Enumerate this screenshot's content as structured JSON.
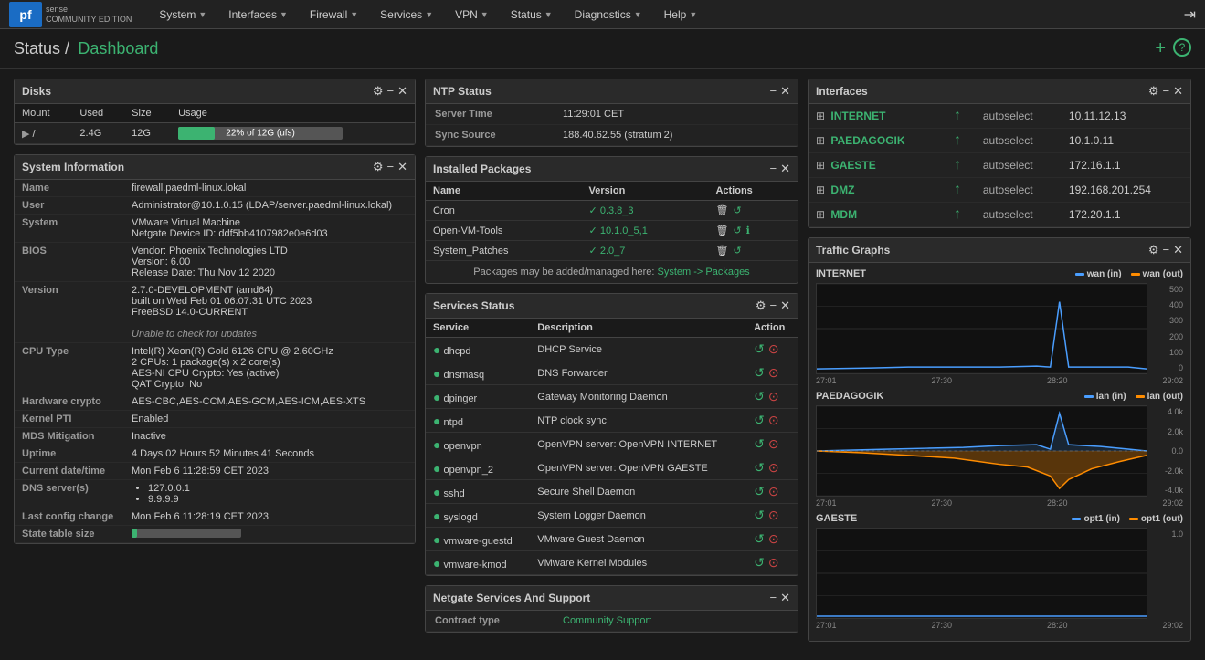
{
  "navbar": {
    "brand": "pf",
    "brand_sub": "COMMUNITY EDITION",
    "items": [
      {
        "label": "System",
        "id": "system"
      },
      {
        "label": "Interfaces",
        "id": "interfaces"
      },
      {
        "label": "Firewall",
        "id": "firewall"
      },
      {
        "label": "Services",
        "id": "services"
      },
      {
        "label": "VPN",
        "id": "vpn"
      },
      {
        "label": "Status",
        "id": "status"
      },
      {
        "label": "Diagnostics",
        "id": "diagnostics"
      },
      {
        "label": "Help",
        "id": "help"
      }
    ]
  },
  "breadcrumb": {
    "prefix": "Status /",
    "current": "Dashboard"
  },
  "disks": {
    "title": "Disks",
    "headers": [
      "Mount",
      "Used",
      "Size",
      "Usage"
    ],
    "rows": [
      {
        "mount": "/",
        "used": "2.4G",
        "size": "12G",
        "usage_pct": 22,
        "usage_label": "22% of 12G (ufs)"
      }
    ]
  },
  "sysinfo": {
    "title": "System Information",
    "rows": [
      {
        "label": "Name",
        "value": "firewall.paedml-linux.lokal"
      },
      {
        "label": "User",
        "value": "Administrator@10.1.0.15 (LDAP/server.paedml-linux.lokal)"
      },
      {
        "label": "System",
        "value": "VMware Virtual Machine\nNetgate Device ID: ddf5bb4107982e0e6d03"
      },
      {
        "label": "BIOS",
        "value": "Vendor: Phoenix Technologies LTD\nVersion: 6.00\nRelease Date: Thu Nov 12 2020"
      },
      {
        "label": "Version",
        "value": "2.7.0-DEVELOPMENT (amd64)\nbuilt on Wed Feb 01 06:07:31 UTC 2023\nFreeBSD 14.0-CURRENT\n\nUnable to check for updates"
      },
      {
        "label": "CPU Type",
        "value": "Intel(R) Xeon(R) Gold 6126 CPU @ 2.60GHz\n2 CPUs: 1 package(s) x 2 core(s)\nAES-NI CPU Crypto: Yes (active)\nQAT Crypto: No"
      },
      {
        "label": "Hardware crypto",
        "value": "AES-CBC,AES-CCM,AES-GCM,AES-ICM,AES-XTS"
      },
      {
        "label": "Kernel PTI",
        "value": "Enabled"
      },
      {
        "label": "MDS Mitigation",
        "value": "Inactive"
      },
      {
        "label": "Uptime",
        "value": "4 Days 02 Hours 52 Minutes 41 Seconds"
      },
      {
        "label": "Current date/time",
        "value": "Mon Feb 6 11:28:59 CET 2023"
      },
      {
        "label": "DNS server(s)",
        "value": "127.0.0.1\n9.9.9.9"
      },
      {
        "label": "Last config change",
        "value": "Mon Feb 6 11:28:19 CET 2023"
      },
      {
        "label": "State table size",
        "value": ""
      }
    ]
  },
  "ntp": {
    "title": "NTP Status",
    "rows": [
      {
        "label": "Server Time",
        "value": "11:29:01 CET"
      },
      {
        "label": "Sync Source",
        "value": "188.40.62.55 (stratum 2)"
      }
    ]
  },
  "packages": {
    "title": "Installed Packages",
    "headers": [
      "Name",
      "Version",
      "Actions"
    ],
    "rows": [
      {
        "name": "Cron",
        "version": "0.3.8_3"
      },
      {
        "name": "Open-VM-Tools",
        "version": "10.1.0_5,1"
      },
      {
        "name": "System_Patches",
        "version": "2.0_7"
      }
    ],
    "note": "Packages may be added/managed here: System -> Packages"
  },
  "services": {
    "title": "Services Status",
    "headers": [
      "Service",
      "Description",
      "Action"
    ],
    "rows": [
      {
        "name": "dhcpd",
        "desc": "DHCP Service"
      },
      {
        "name": "dnsmasq",
        "desc": "DNS Forwarder"
      },
      {
        "name": "dpinger",
        "desc": "Gateway Monitoring Daemon"
      },
      {
        "name": "ntpd",
        "desc": "NTP clock sync"
      },
      {
        "name": "openvpn",
        "desc": "OpenVPN server: OpenVPN INTERNET"
      },
      {
        "name": "openvpn_2",
        "desc": "OpenVPN server: OpenVPN GAESTE"
      },
      {
        "name": "sshd",
        "desc": "Secure Shell Daemon"
      },
      {
        "name": "syslogd",
        "desc": "System Logger Daemon"
      },
      {
        "name": "vmware-guestd",
        "desc": "VMware Guest Daemon"
      },
      {
        "name": "vmware-kmod",
        "desc": "VMware Kernel Modules"
      }
    ]
  },
  "netgate": {
    "title": "Netgate Services And Support",
    "rows": [
      {
        "label": "Contract type",
        "value": "Community Support"
      }
    ]
  },
  "interfaces": {
    "title": "Interfaces",
    "rows": [
      {
        "name": "INTERNET",
        "type": "autoselect",
        "ip": "10.11.12.13"
      },
      {
        "name": "PAEDAGOGIK",
        "type": "autoselect",
        "ip": "10.1.0.11"
      },
      {
        "name": "GAESTE",
        "type": "autoselect",
        "ip": "172.16.1.1"
      },
      {
        "name": "DMZ",
        "type": "autoselect",
        "ip": "192.168.201.254"
      },
      {
        "name": "MDM",
        "type": "autoselect",
        "ip": "172.20.1.1"
      }
    ]
  },
  "traffic_graphs": {
    "title": "Traffic Graphs",
    "graphs": [
      {
        "id": "internet",
        "title": "INTERNET",
        "legend_in": "wan (in)",
        "legend_out": "wan (out)",
        "color_in": "#1e90ff",
        "color_out": "#ff8c00",
        "y_labels": [
          "500",
          "400",
          "300",
          "200",
          "100",
          "0"
        ],
        "time_labels": [
          "27:01",
          "27:30",
          "28:20",
          "29:02"
        ]
      },
      {
        "id": "paedagogik",
        "title": "PAEDAGOGIK",
        "legend_in": "lan (in)",
        "legend_out": "lan (out)",
        "color_in": "#1e90ff",
        "color_out": "#ff8c00",
        "y_labels": [
          "4.0k",
          "2.0k",
          "0.0",
          "-2.0k",
          "-4.0k"
        ],
        "time_labels": [
          "27:01",
          "27:30",
          "28:20",
          "29:02"
        ]
      },
      {
        "id": "gaeste",
        "title": "GAESTE",
        "legend_in": "opt1 (in)",
        "legend_out": "opt1 (out)",
        "color_in": "#1e90ff",
        "color_out": "#ff8c00",
        "y_labels": [
          "1.0",
          "",
          "",
          "",
          ""
        ],
        "time_labels": [
          "27:01",
          "27:30",
          "28:20",
          "29:02"
        ]
      }
    ]
  }
}
